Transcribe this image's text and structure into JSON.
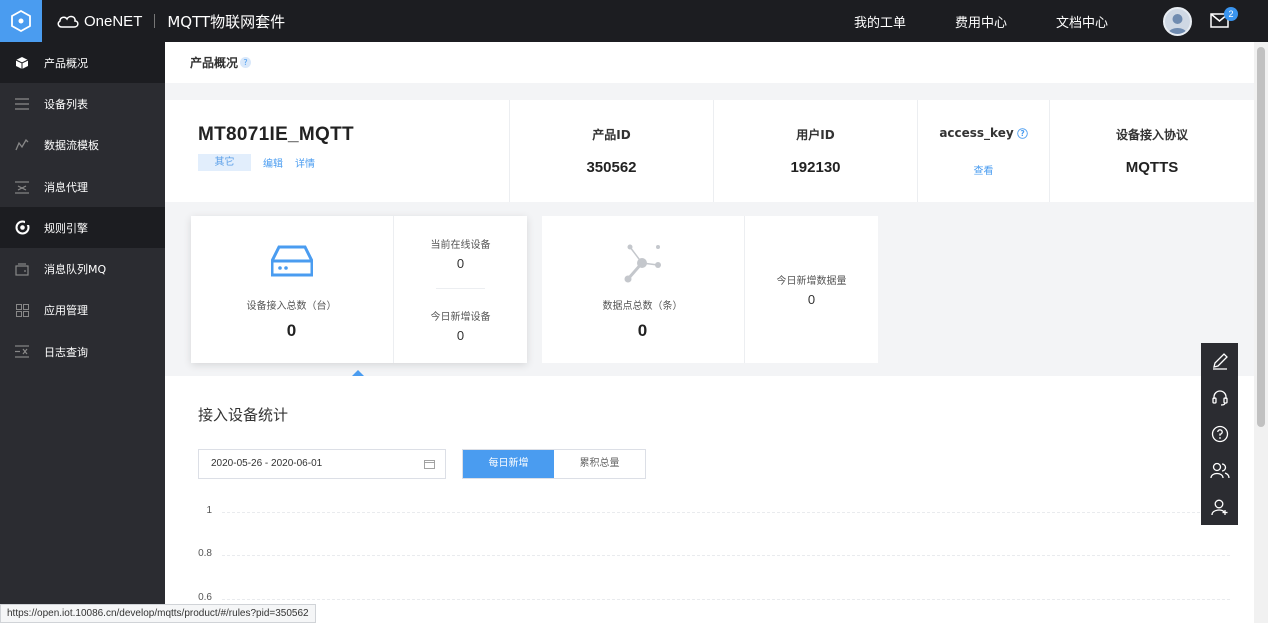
{
  "header": {
    "logo_text": "OneNET",
    "suite_title": "MQTT物联网套件",
    "nav": [
      "我的工单",
      "费用中心",
      "文档中心"
    ],
    "mail_badge": "2"
  },
  "sidebar": {
    "items": [
      {
        "label": "产品概况",
        "icon": "cube-icon"
      },
      {
        "label": "设备列表",
        "icon": "list-icon"
      },
      {
        "label": "数据流模板",
        "icon": "chart-line-icon"
      },
      {
        "label": "消息代理",
        "icon": "message-proxy-icon"
      },
      {
        "label": "规则引擎",
        "icon": "rule-engine-icon"
      },
      {
        "label": "消息队列MQ",
        "icon": "queue-icon"
      },
      {
        "label": "应用管理",
        "icon": "grid-icon"
      },
      {
        "label": "日志查询",
        "icon": "log-icon"
      }
    ]
  },
  "page": {
    "title": "产品概况",
    "help": "?"
  },
  "product": {
    "name": "MT8071IE_MQTT",
    "tag": "其它",
    "edit": "编辑",
    "detail": "详情",
    "cells": [
      {
        "label": "产品ID",
        "value": "350562"
      },
      {
        "label": "用户ID",
        "value": "192130"
      },
      {
        "label": "access_key",
        "value": "查看"
      },
      {
        "label": "设备接入协议",
        "value": "MQTTS"
      }
    ]
  },
  "device_card": {
    "total_label": "设备接入总数（台）",
    "total_value": "0",
    "online_label": "当前在线设备",
    "online_value": "0",
    "today_label": "今日新增设备",
    "today_value": "0"
  },
  "data_card": {
    "total_label": "数据点总数（条）",
    "total_value": "0",
    "today_label": "今日新增数据量",
    "today_value": "0"
  },
  "stats": {
    "title": "接入设备统计",
    "date_range": "2020-05-26 - 2020-06-01",
    "btn_daily": "每日新增",
    "btn_total": "累积总量",
    "y_ticks": [
      "1",
      "0.8",
      "0.6"
    ]
  },
  "status_url": "https://open.iot.10086.cn/develop/mqtts/product/#/rules?pid=350562"
}
